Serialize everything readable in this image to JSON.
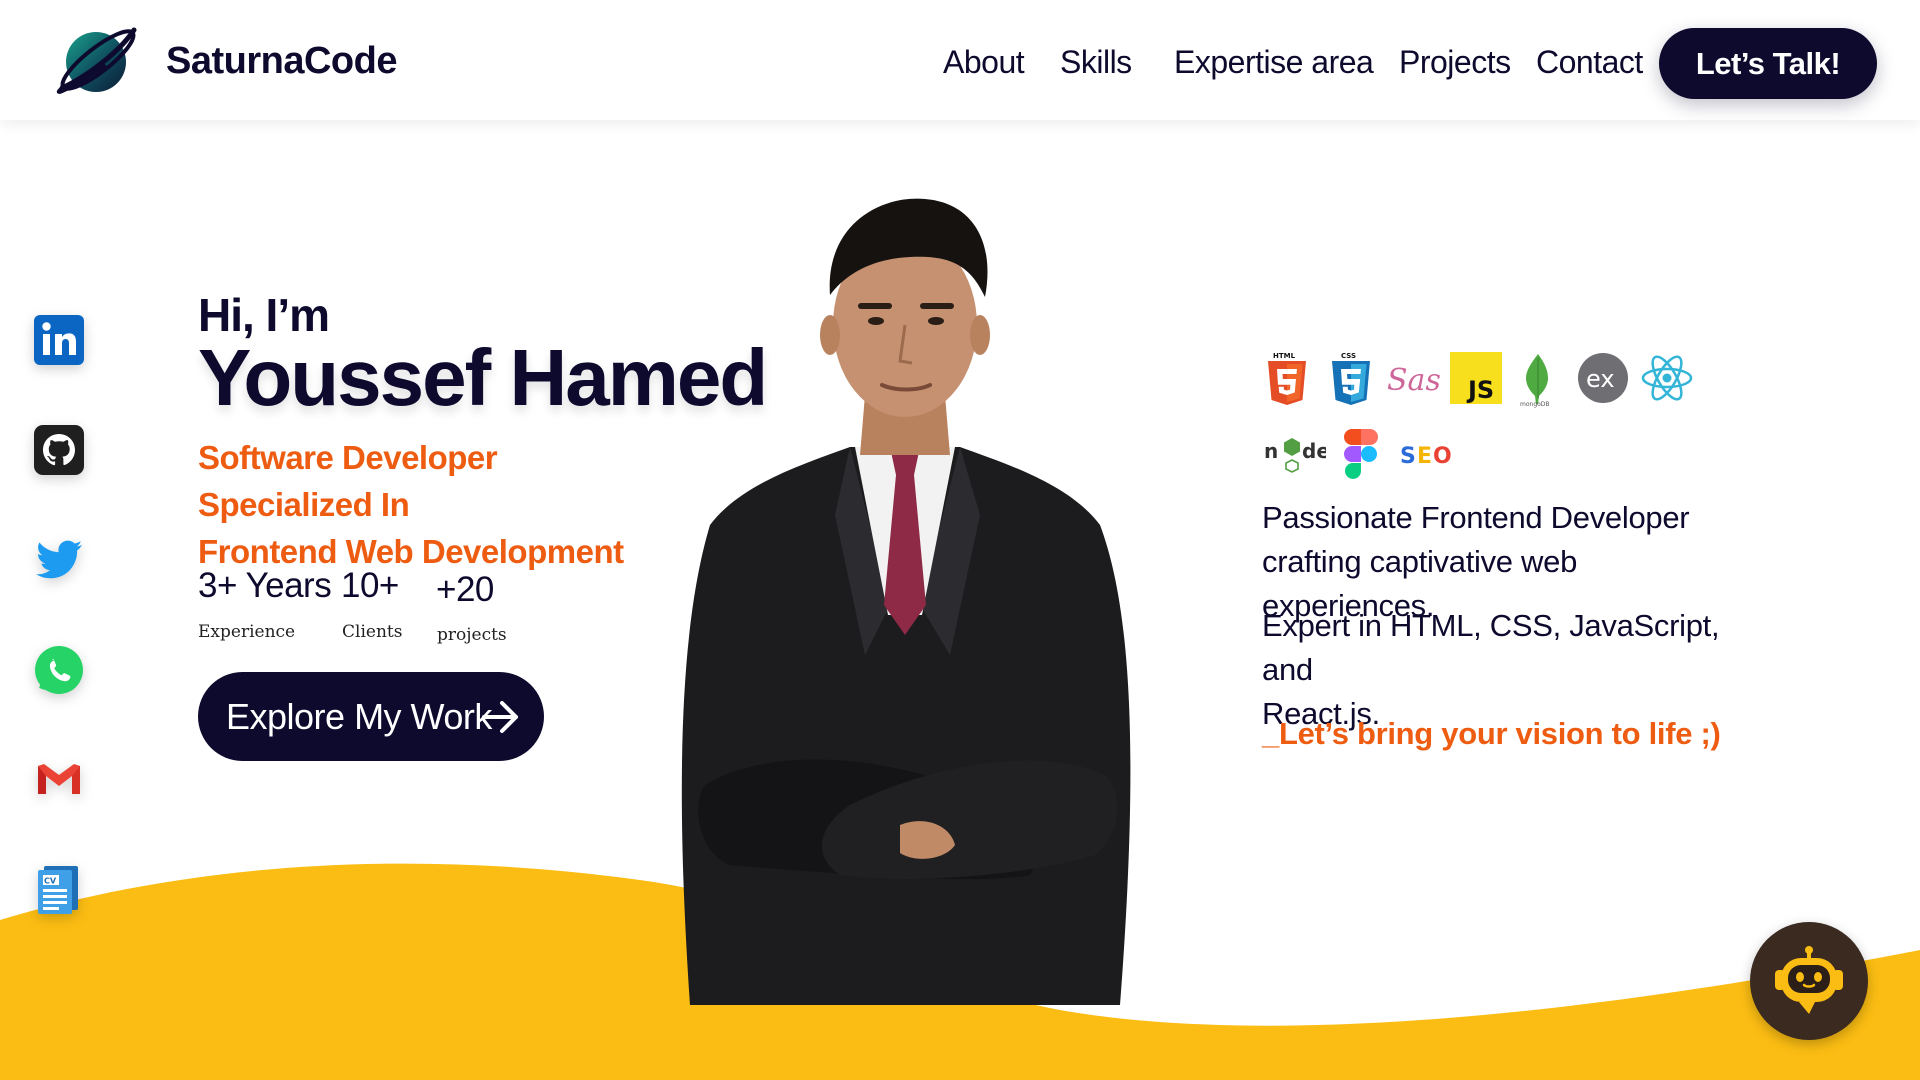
{
  "header": {
    "brand": "SaturnaCode",
    "nav": [
      "About",
      "Skills",
      "Expertise area",
      "Projects",
      "Contact"
    ],
    "cta_label": "Let’s Talk!"
  },
  "socials": [
    "linkedin-icon",
    "github-icon",
    "twitter-icon",
    "whatsapp-icon",
    "gmail-icon",
    "cv-icon"
  ],
  "hero": {
    "greeting": "Hi, I’m",
    "name": "Youssef Hamed",
    "role_line1": "Software Developer Specialized In",
    "role_line2": "Frontend Web Development",
    "stats": [
      {
        "value": "3+ Years",
        "label": "Experience"
      },
      {
        "value": "10+",
        "label": "Clients"
      },
      {
        "value": "+20",
        "label": "projects"
      }
    ],
    "explore_label": "Explore My Work"
  },
  "tech_icons": [
    "HTML",
    "CSS",
    "Sass",
    "JS",
    "mongoDB",
    "ex",
    "react",
    "node",
    "figma",
    "SEO"
  ],
  "about": {
    "line1": "Passionate Frontend Developer",
    "line2": "crafting captivative web experiences.",
    "line3": "Expert in HTML, CSS, JavaScript, and",
    "line4": "React.js.",
    "tagline": "_Let’s bring your vision to life ;)"
  },
  "colors": {
    "navy": "#0d0a2e",
    "orange": "#ee5c12",
    "wave": "#fbbd13"
  }
}
